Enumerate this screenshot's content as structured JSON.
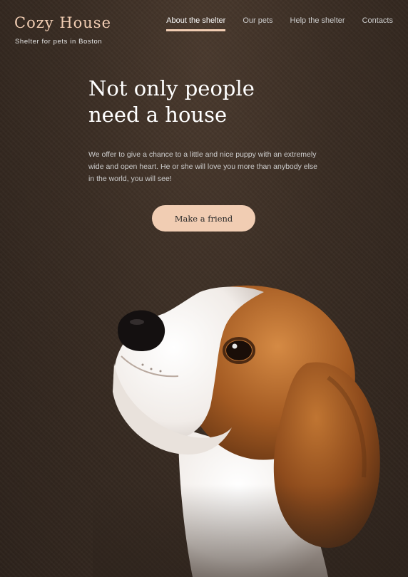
{
  "header": {
    "logo_title": "Cozy House",
    "logo_subtitle": "Shelter for pets in Boston"
  },
  "nav": {
    "items": [
      {
        "label": "About the shelter",
        "active": true
      },
      {
        "label": "Our pets",
        "active": false
      },
      {
        "label": "Help the shelter",
        "active": false
      },
      {
        "label": "Contacts",
        "active": false
      }
    ]
  },
  "hero": {
    "title_line1": "Not only people",
    "title_line2": "need a house",
    "text": "We offer to give a chance to a little and nice puppy with an extremely wide and open heart. He or she will love you more than anybody else in the world, you will see!",
    "button_label": "Make a friend"
  },
  "colors": {
    "accent": "#f1cdb3",
    "background": "#3a2d24",
    "text_light": "#cdcdcd",
    "title": "#ffffff"
  }
}
